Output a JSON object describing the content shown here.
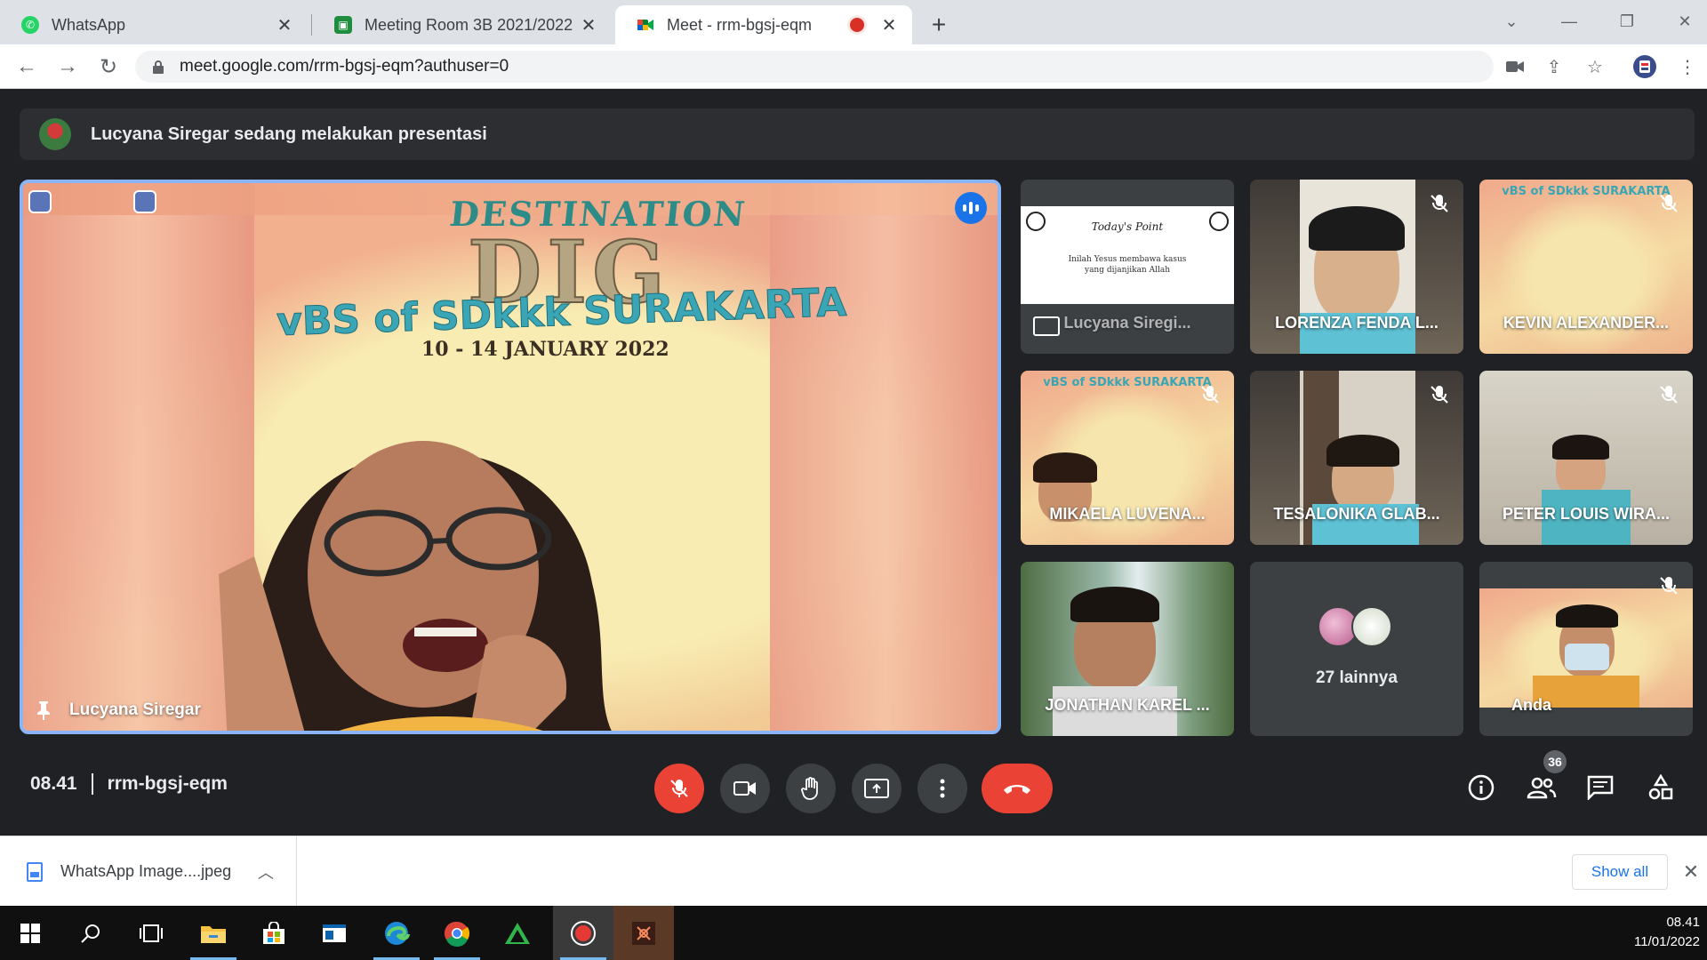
{
  "browser": {
    "tabs": [
      {
        "title": "WhatsApp",
        "icon": "whatsapp-icon",
        "color": "#25d366"
      },
      {
        "title": "Meeting Room 3B 2021/2022",
        "icon": "classroom-icon",
        "color": "#1e8e3e"
      },
      {
        "title": "Meet - rrm-bgsj-eqm",
        "icon": "google-meet-icon",
        "recording": true
      }
    ],
    "url": "meet.google.com/rrm-bgsj-eqm?authuser=0"
  },
  "meet": {
    "banner": "Lucyana Siregar sedang melakukan presentasi",
    "main_tile": {
      "name": "Lucyana Siregar",
      "slide_title_1": "DESTINATION",
      "slide_title_2": "DIG",
      "slide_subtitle": "vBS of SDkkk SURAKARTA",
      "slide_dates": "10 - 14 JANUARY 2022"
    },
    "participants": [
      {
        "name": "Lucyana Siregi...",
        "type": "presentation",
        "muted": false
      },
      {
        "name": "LORENZA FENDA L...",
        "type": "camera",
        "muted": true
      },
      {
        "name": "KEVIN ALEXANDER...",
        "type": "camera",
        "muted": true
      },
      {
        "name": "MIKAELA LUVENA...",
        "type": "camera",
        "muted": true
      },
      {
        "name": "TESALONIKA GLAB...",
        "type": "camera",
        "muted": true
      },
      {
        "name": "PETER LOUIS WIRA...",
        "type": "camera",
        "muted": true
      },
      {
        "name": "JONATHAN KAREL ...",
        "type": "camera",
        "muted": false
      },
      {
        "name": "27 lainnya",
        "type": "others",
        "muted": false
      },
      {
        "name": "Anda",
        "type": "camera",
        "muted": true
      }
    ],
    "presentation_slide": {
      "heading": "Today's Point",
      "body": "Inilah Yesus membawa kasus yang dijanjikan Allah"
    },
    "time": "08.41",
    "meeting_code": "rrm-bgsj-eqm",
    "participant_count": "36",
    "colors": {
      "accent": "#8ab4f8",
      "danger": "#ea4335",
      "surface": "#3c4043"
    }
  },
  "downloads": {
    "file_name": "WhatsApp Image....jpeg",
    "show_all": "Show all"
  },
  "taskbar": {
    "time": "08.41",
    "date": "11/01/2022"
  }
}
